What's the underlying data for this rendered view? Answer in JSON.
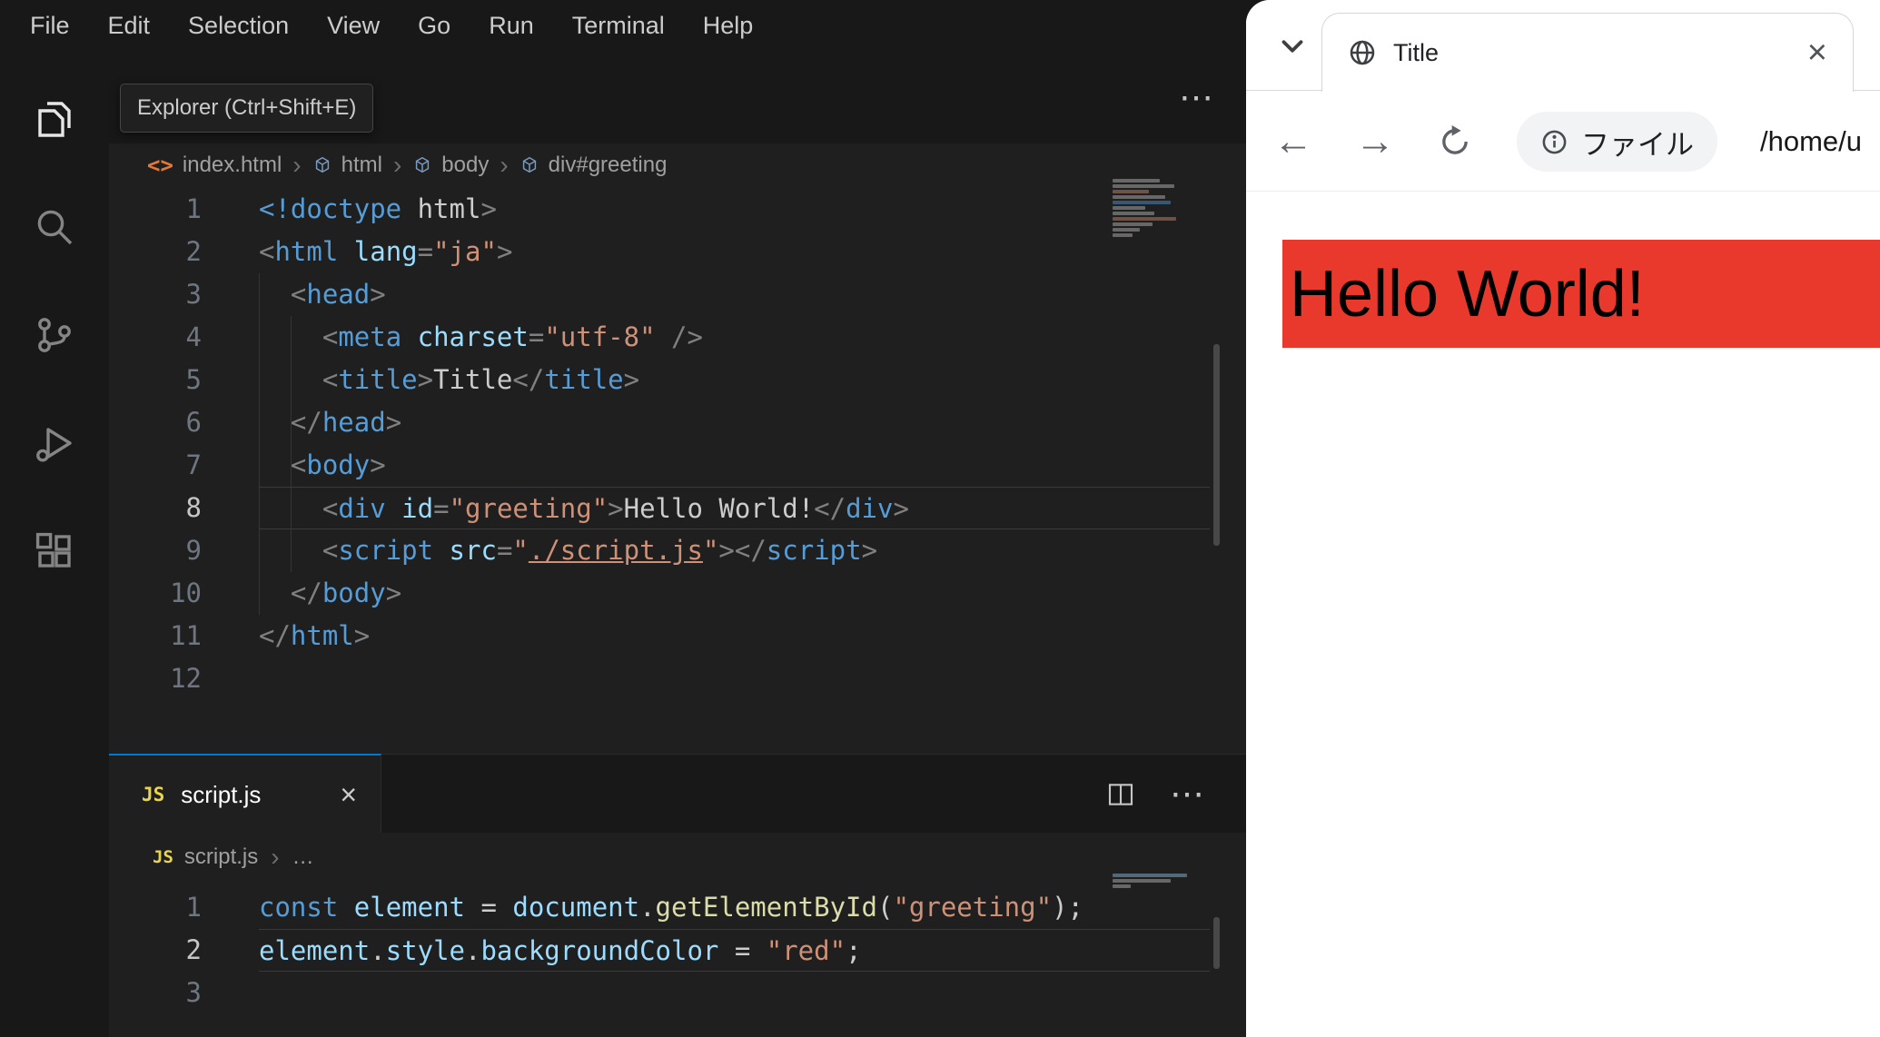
{
  "colors": {
    "red": "#e8392c",
    "tab_accent": "#0078d4",
    "editor_bg": "#1f1f1f",
    "chrome_bg": "#181818"
  },
  "icons": {
    "more": "⋯",
    "close": "×",
    "chevron_right": "›",
    "back": "←",
    "forward": "→",
    "code_file": "<>",
    "js_badge": "JS"
  },
  "menu_bar": {
    "items": [
      "File",
      "Edit",
      "Selection",
      "View",
      "Go",
      "Run",
      "Terminal",
      "Help"
    ]
  },
  "activity_bar": {
    "tooltip": "Explorer (Ctrl+Shift+E)",
    "items": [
      "explorer",
      "search",
      "source-control",
      "run-debug",
      "extensions"
    ]
  },
  "html_editor": {
    "breadcrumb": {
      "file": "index.html",
      "segments": [
        "html",
        "body",
        "div#greeting"
      ]
    },
    "lines": [
      {
        "num": "1",
        "tokens": [
          [
            "<!doctype",
            "tag"
          ],
          [
            " html",
            "text"
          ],
          [
            ">",
            "punct"
          ]
        ]
      },
      {
        "num": "2",
        "tokens": [
          [
            "<",
            "punct"
          ],
          [
            "html",
            "tag"
          ],
          [
            " ",
            "text"
          ],
          [
            "lang",
            "attr"
          ],
          [
            "=",
            "punct"
          ],
          [
            "\"ja\"",
            "str"
          ],
          [
            ">",
            "punct"
          ]
        ]
      },
      {
        "num": "3",
        "tokens": [
          [
            "  ",
            "text"
          ],
          [
            "<",
            "punct"
          ],
          [
            "head",
            "tag"
          ],
          [
            ">",
            "punct"
          ]
        ]
      },
      {
        "num": "4",
        "tokens": [
          [
            "    ",
            "text"
          ],
          [
            "<",
            "punct"
          ],
          [
            "meta",
            "tag"
          ],
          [
            " ",
            "text"
          ],
          [
            "charset",
            "attr"
          ],
          [
            "=",
            "punct"
          ],
          [
            "\"utf-8\"",
            "str"
          ],
          [
            " /",
            "punct"
          ],
          [
            ">",
            "punct"
          ]
        ]
      },
      {
        "num": "5",
        "tokens": [
          [
            "    ",
            "text"
          ],
          [
            "<",
            "punct"
          ],
          [
            "title",
            "tag"
          ],
          [
            ">",
            "punct"
          ],
          [
            "Title",
            "text"
          ],
          [
            "</",
            "punct"
          ],
          [
            "title",
            "tag"
          ],
          [
            ">",
            "punct"
          ]
        ]
      },
      {
        "num": "6",
        "tokens": [
          [
            "  ",
            "text"
          ],
          [
            "</",
            "punct"
          ],
          [
            "head",
            "tag"
          ],
          [
            ">",
            "punct"
          ]
        ]
      },
      {
        "num": "7",
        "tokens": [
          [
            "  ",
            "text"
          ],
          [
            "<",
            "punct"
          ],
          [
            "body",
            "tag"
          ],
          [
            ">",
            "punct"
          ]
        ]
      },
      {
        "num": "8",
        "current": true,
        "tokens": [
          [
            "    ",
            "text"
          ],
          [
            "<",
            "punct"
          ],
          [
            "div",
            "tag"
          ],
          [
            " ",
            "text"
          ],
          [
            "id",
            "attr"
          ],
          [
            "=",
            "punct"
          ],
          [
            "\"greeting\"",
            "str"
          ],
          [
            ">",
            "punct"
          ],
          [
            "Hello World!",
            "text"
          ],
          [
            "</",
            "punct"
          ],
          [
            "div",
            "tag"
          ],
          [
            ">",
            "punct"
          ]
        ]
      },
      {
        "num": "9",
        "tokens": [
          [
            "    ",
            "text"
          ],
          [
            "<",
            "punct"
          ],
          [
            "script",
            "tag"
          ],
          [
            " ",
            "text"
          ],
          [
            "src",
            "attr"
          ],
          [
            "=",
            "punct"
          ],
          [
            "\"",
            "str"
          ],
          [
            "./script.js",
            "link"
          ],
          [
            "\"",
            "str"
          ],
          [
            ">",
            "punct"
          ],
          [
            "</",
            "punct"
          ],
          [
            "script",
            "tag"
          ],
          [
            ">",
            "punct"
          ]
        ]
      },
      {
        "num": "10",
        "tokens": [
          [
            "  ",
            "text"
          ],
          [
            "</",
            "punct"
          ],
          [
            "body",
            "tag"
          ],
          [
            ">",
            "punct"
          ]
        ]
      },
      {
        "num": "11",
        "tokens": [
          [
            "</",
            "punct"
          ],
          [
            "html",
            "tag"
          ],
          [
            ">",
            "punct"
          ]
        ]
      },
      {
        "num": "12",
        "tokens": []
      }
    ]
  },
  "panel": {
    "tab_label": "script.js",
    "breadcrumb_file": "script.js",
    "breadcrumb_more": "…"
  },
  "js_editor": {
    "lines": [
      {
        "num": "1",
        "tokens": [
          [
            "const",
            "kw"
          ],
          [
            " ",
            "text"
          ],
          [
            "element",
            "var"
          ],
          [
            " = ",
            "text"
          ],
          [
            "document",
            "var"
          ],
          [
            ".",
            "text"
          ],
          [
            "getElementById",
            "fn"
          ],
          [
            "(",
            "text"
          ],
          [
            "\"greeting\"",
            "str"
          ],
          [
            ")",
            "text"
          ],
          [
            ";",
            "text"
          ]
        ]
      },
      {
        "num": "2",
        "current": true,
        "tokens": [
          [
            "element",
            "var"
          ],
          [
            ".",
            "text"
          ],
          [
            "style",
            "var"
          ],
          [
            ".",
            "text"
          ],
          [
            "backgroundColor",
            "var"
          ],
          [
            " = ",
            "text"
          ],
          [
            "\"red\"",
            "str"
          ],
          [
            ";",
            "text"
          ]
        ]
      },
      {
        "num": "3",
        "tokens": []
      }
    ]
  },
  "browser": {
    "tab_title": "Title",
    "chip_label": "ファイル",
    "url": "/home/u",
    "page_text": "Hello World!"
  }
}
